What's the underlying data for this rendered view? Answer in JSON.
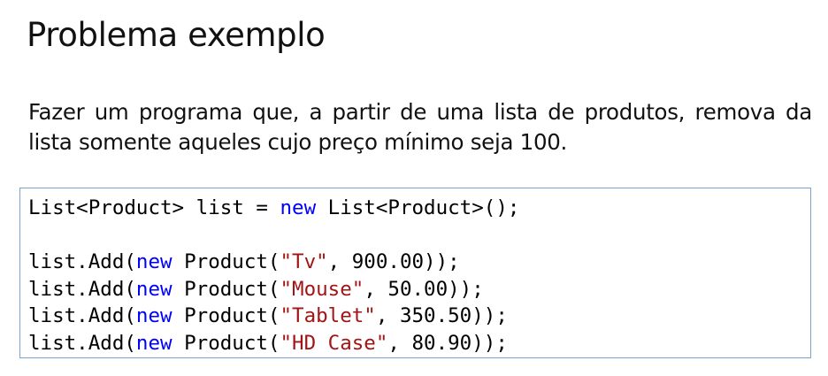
{
  "slide": {
    "title": "Problema exemplo",
    "description": "Fazer um programa que, a partir de uma lista de produtos, remova da lista somente aqueles cujo preço mínimo seja 100."
  },
  "code": {
    "colors": {
      "keyword": "#0000ff",
      "string": "#a31515",
      "plain": "#000000",
      "border": "#7aa3cf"
    },
    "lines": [
      {
        "plain1": "List<Product> list = ",
        "keyword": "new",
        "plain2": " List<Product>();"
      },
      {},
      {
        "plain1": "list.Add(",
        "keyword": "new",
        "plain2": " Product(",
        "string": "\"Tv\"",
        "plain3": ", 900.00));"
      },
      {
        "plain1": "list.Add(",
        "keyword": "new",
        "plain2": " Product(",
        "string": "\"Mouse\"",
        "plain3": ", 50.00));"
      },
      {
        "plain1": "list.Add(",
        "keyword": "new",
        "plain2": " Product(",
        "string": "\"Tablet\"",
        "plain3": ", 350.50));"
      },
      {
        "plain1": "list.Add(",
        "keyword": "new",
        "plain2": " Product(",
        "string": "\"HD Case\"",
        "plain3": ", 80.90));"
      }
    ]
  }
}
